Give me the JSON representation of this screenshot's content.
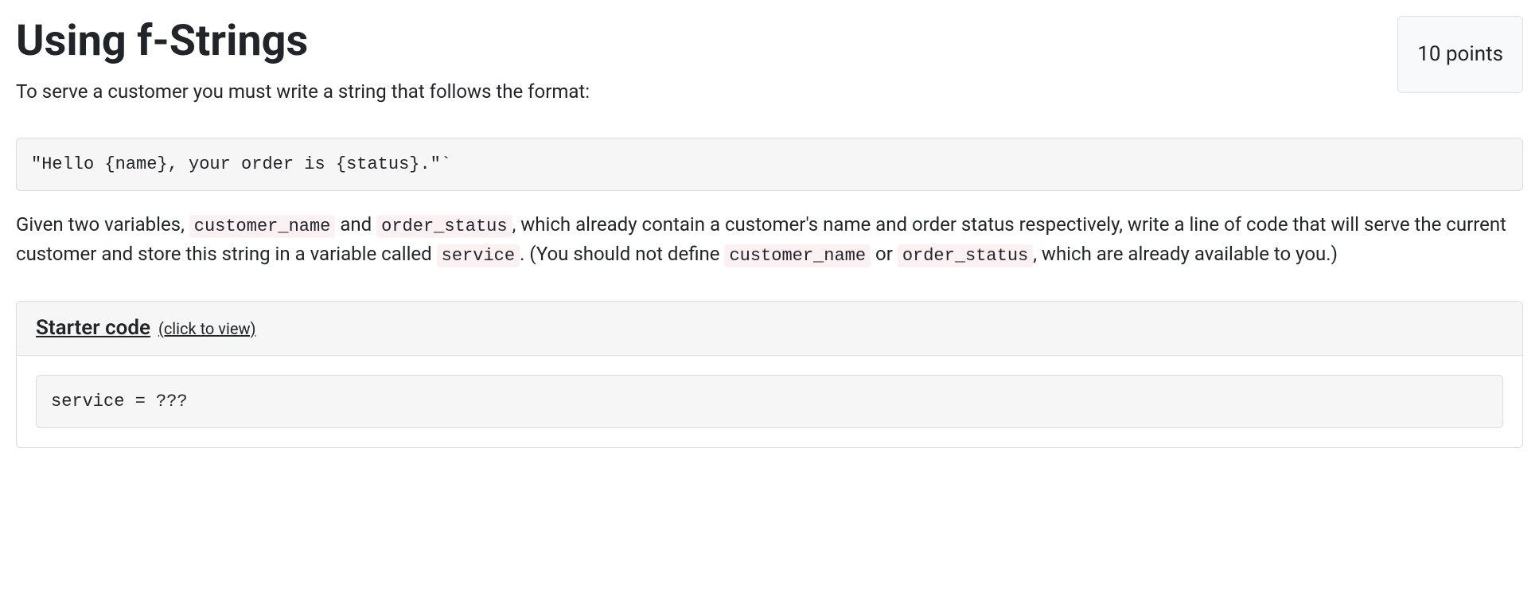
{
  "heading": "Using f-Strings",
  "points_label": "10 points",
  "intro": "To serve a customer you must write a string that follows the format:",
  "format_code": "\"Hello {name}, your order is {status}.\"`",
  "desc": {
    "part1": "Given two variables, ",
    "var1": "customer_name",
    "part2": " and ",
    "var2": "order_status",
    "part3": ", which already contain a customer's name and order status respectively, write a line of code that will serve the current customer and store this string in a variable called ",
    "var3": "service",
    "part4": ". (You should not define ",
    "var4": "customer_name",
    "part5": " or ",
    "var5": "order_status",
    "part6": ", which are already available to you.)"
  },
  "starter": {
    "title": "Starter code",
    "hint": "(click to view)",
    "code": "service = ???"
  }
}
